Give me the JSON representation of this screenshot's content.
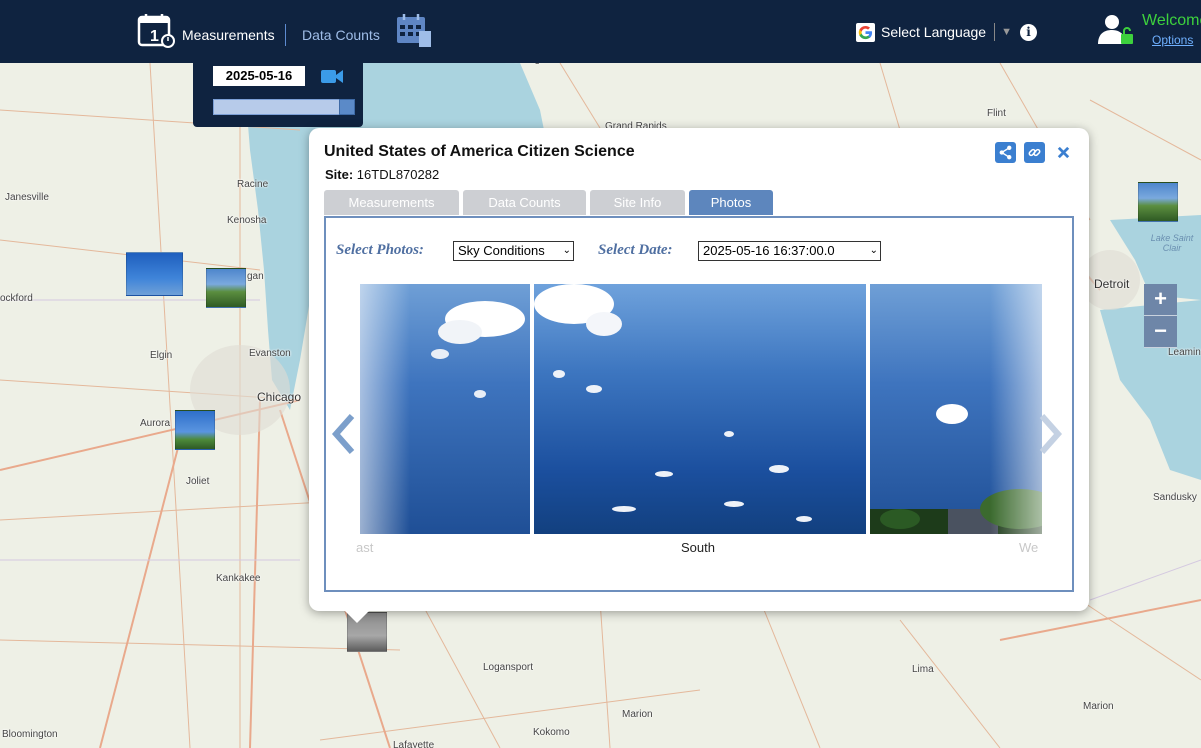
{
  "nav": {
    "measurements_label": "Measurements",
    "data_counts_label": "Data Counts",
    "language_label": "Select Language",
    "welcome_text": "Welcome",
    "options_label": "Options"
  },
  "date_panel": {
    "date": "2025-05-16",
    "slider_level": 1.0
  },
  "map": {
    "places": [
      {
        "name": "Janesville"
      },
      {
        "name": "Racine"
      },
      {
        "name": "Kenosha"
      },
      {
        "name": "ockford"
      },
      {
        "name": "Elgin"
      },
      {
        "name": "Evanston"
      },
      {
        "name": "Chicago"
      },
      {
        "name": "Aurora"
      },
      {
        "name": "Joliet"
      },
      {
        "name": "Kankakee"
      },
      {
        "name": "Logansport"
      },
      {
        "name": "Marion"
      },
      {
        "name": "Kokomo"
      },
      {
        "name": "Bloomington"
      },
      {
        "name": "Lafayette"
      },
      {
        "name": "Lima"
      },
      {
        "name": "Marion"
      },
      {
        "name": "Flint"
      },
      {
        "name": "Grand Rapids"
      },
      {
        "name": "Muskegon"
      },
      {
        "name": "Detroit"
      },
      {
        "name": "Sandusky"
      },
      {
        "name": "Leamin"
      },
      {
        "name": "gan"
      },
      {
        "name": "Lake Saint Clair"
      }
    ],
    "zoom_in": "+",
    "zoom_out": "−"
  },
  "popup": {
    "title": "United States of America Citizen Science",
    "site_label": "Site:",
    "site_id": "16TDL870282",
    "tabs": [
      {
        "label": "Measurements",
        "active": false
      },
      {
        "label": "Data Counts",
        "active": false
      },
      {
        "label": "Site Info",
        "active": false
      },
      {
        "label": "Photos",
        "active": true
      }
    ],
    "select_photos_label": "Select Photos:",
    "select_photos_value": "Sky Conditions",
    "select_date_label": "Select Date:",
    "select_date_value": "2025-05-16 16:37:00.0",
    "captions": {
      "left": "ast",
      "center": "South",
      "right": "We"
    }
  },
  "colors": {
    "topbar": "#0f2340",
    "accent_blue": "#3b7fd0",
    "active_tab": "#5d86bd",
    "welcome_green": "#3dd13d"
  }
}
